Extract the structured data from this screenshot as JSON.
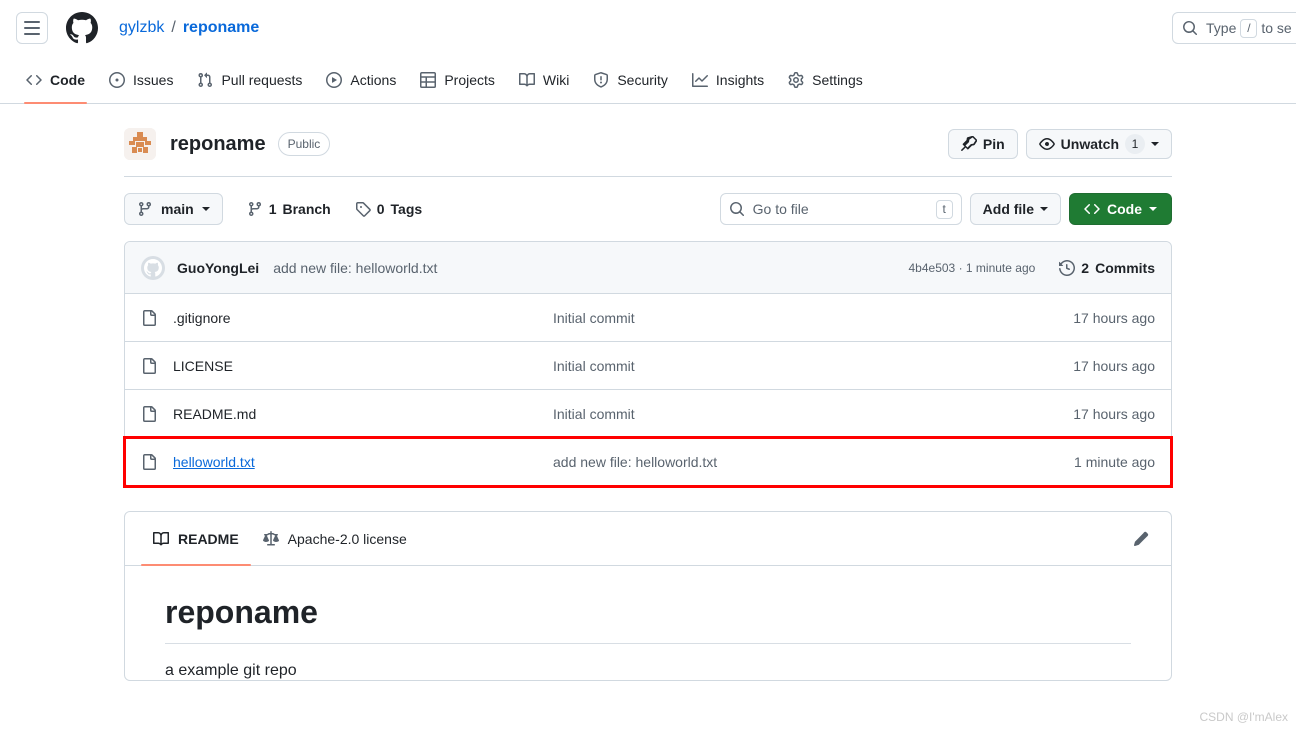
{
  "header": {
    "menu_icon": "hamburger-menu-icon",
    "logo_icon": "github-logo-icon",
    "owner": "gylzbk",
    "separator": "/",
    "repo": "reponame",
    "search": {
      "icon": "search-icon",
      "placeholder_before": "Type",
      "kbd": "/",
      "placeholder_after": "to se"
    }
  },
  "repo_nav": {
    "items": [
      {
        "label": "Code",
        "icon": "code-icon",
        "active": true
      },
      {
        "label": "Issues",
        "icon": "issue-opened-icon",
        "active": false
      },
      {
        "label": "Pull requests",
        "icon": "git-pull-request-icon",
        "active": false
      },
      {
        "label": "Actions",
        "icon": "play-icon",
        "active": false
      },
      {
        "label": "Projects",
        "icon": "table-icon",
        "active": false
      },
      {
        "label": "Wiki",
        "icon": "book-icon",
        "active": false
      },
      {
        "label": "Security",
        "icon": "shield-icon",
        "active": false
      },
      {
        "label": "Insights",
        "icon": "graph-icon",
        "active": false
      },
      {
        "label": "Settings",
        "icon": "gear-icon",
        "active": false
      }
    ]
  },
  "repo_header": {
    "avatar_icon": "repo-avatar-identicon",
    "name": "reponame",
    "visibility": "Public",
    "pin_label": "Pin",
    "pin_icon": "pin-icon",
    "watch_label": "Unwatch",
    "watch_icon": "eye-icon",
    "watch_count": "1"
  },
  "controls": {
    "branch_icon": "git-branch-icon",
    "branch_name": "main",
    "branches_count": "1",
    "branches_label": "Branch",
    "tags_icon": "tag-icon",
    "tags_count": "0",
    "tags_label": "Tags",
    "file_search_placeholder": "Go to file",
    "file_search_kbd": "t",
    "add_file_label": "Add file",
    "code_label": "Code",
    "code_icon": "code-icon"
  },
  "commit_header": {
    "avatar_icon": "user-avatar-icon",
    "author": "GuoYongLei",
    "message": "add new file: helloworld.txt",
    "sha": "4b4e503",
    "dot": "·",
    "relative_time": "1 minute ago",
    "history_icon": "history-icon",
    "commits_count": "2",
    "commits_label": "Commits"
  },
  "files": [
    {
      "icon": "file-icon",
      "name": ".gitignore",
      "commit": "Initial commit",
      "time": "17 hours ago",
      "highlighted": false,
      "linked": false
    },
    {
      "icon": "file-icon",
      "name": "LICENSE",
      "commit": "Initial commit",
      "time": "17 hours ago",
      "highlighted": false,
      "linked": false
    },
    {
      "icon": "file-icon",
      "name": "README.md",
      "commit": "Initial commit",
      "time": "17 hours ago",
      "highlighted": false,
      "linked": false
    },
    {
      "icon": "file-icon",
      "name": "helloworld.txt",
      "commit": "add new file: helloworld.txt",
      "time": "1 minute ago",
      "highlighted": true,
      "linked": true
    }
  ],
  "readme": {
    "tabs": [
      {
        "label": "README",
        "icon": "book-icon",
        "active": true
      },
      {
        "label": "Apache-2.0 license",
        "icon": "law-icon",
        "active": false
      }
    ],
    "edit_icon": "pencil-icon",
    "heading": "reponame",
    "paragraph": "a example git repo"
  },
  "watermark": "CSDN @I'mAlex",
  "colors": {
    "accent_underline": "#fd8c73",
    "link": "#0969da",
    "green_button": "#1f7b33",
    "highlight_outline": "#ff0000",
    "border": "#d1d9e0",
    "muted_text": "#59636e"
  }
}
